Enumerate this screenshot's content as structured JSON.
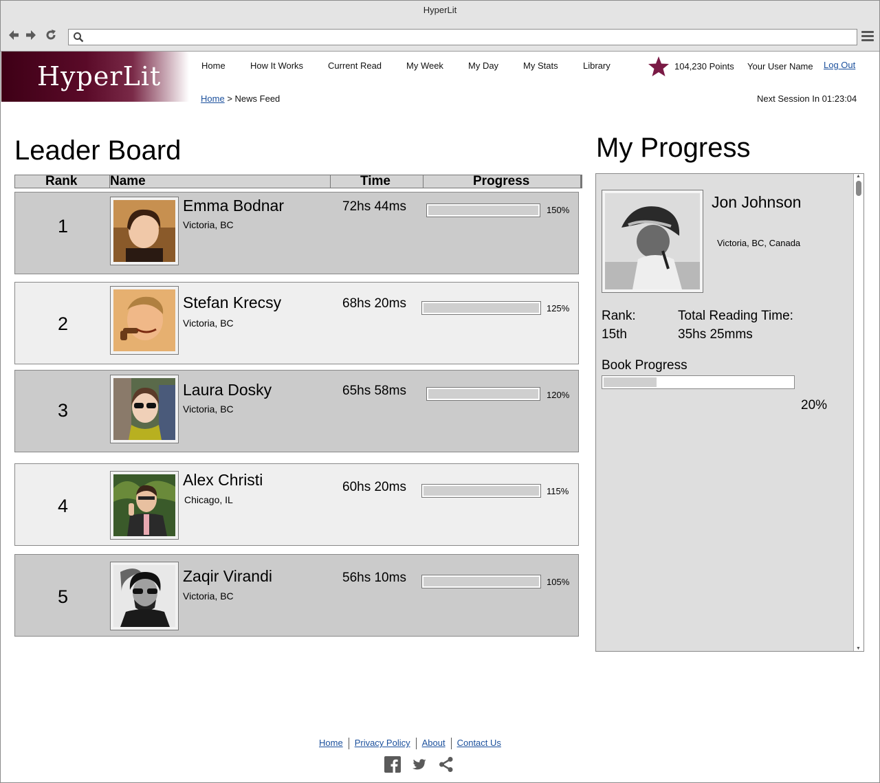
{
  "window": {
    "title": "HyperLit"
  },
  "browser": {
    "url": ""
  },
  "brand": {
    "logo_text": "HyperLit",
    "accent_color": "#5a0a28",
    "star_color": "#7a1a45"
  },
  "nav": {
    "items": [
      "Home",
      "How It Works",
      "Current Read",
      "My Week",
      "My Day",
      "My Stats",
      "Library"
    ]
  },
  "user_bar": {
    "points": "104,230 Points",
    "username": "Your User Name",
    "logout": "Log Out"
  },
  "breadcrumb": {
    "home": "Home",
    "separator": ">",
    "current": "News Feed"
  },
  "session": {
    "next": "Next Session In 01:23:04"
  },
  "leaderboard": {
    "title": "Leader Board",
    "columns": [
      "Rank",
      "Name",
      "Time",
      "Progress"
    ],
    "rows": [
      {
        "rank": "1",
        "name": "Emma Bodnar",
        "location": "Victoria, BC",
        "time": "72hs 44ms",
        "progress": "150%",
        "progress_value": 1.0
      },
      {
        "rank": "2",
        "name": "Stefan Krecsy",
        "location": "Victoria, BC",
        "time": "68hs 20ms",
        "progress": "125%",
        "progress_value": 1.0
      },
      {
        "rank": "3",
        "name": "Laura Dosky",
        "location": "Victoria, BC",
        "time": "65hs 58ms",
        "progress": "120%",
        "progress_value": 1.0
      },
      {
        "rank": "4",
        "name": "Alex Christi",
        "location": "Chicago, IL",
        "time": "60hs 20ms",
        "progress": "115%",
        "progress_value": 1.0
      },
      {
        "rank": "5",
        "name": "Zaqir Virandi",
        "location": "Victoria, BC",
        "time": "56hs 10ms",
        "progress": "105%",
        "progress_value": 1.0
      }
    ]
  },
  "my_progress": {
    "title": "My Progress",
    "name": "Jon Johnson",
    "location": "Victoria, BC, Canada",
    "rank_label": "Rank:",
    "rank_value": "15th",
    "time_label": "Total Reading Time:",
    "time_value": "35hs 25mms",
    "book_label": "Book Progress",
    "book_percent": "20%",
    "book_value": 0.28
  },
  "footer": {
    "links": [
      "Home",
      "Privacy Policy",
      "About",
      "Contact Us"
    ]
  },
  "social": {
    "icons": [
      "facebook-icon",
      "twitter-icon",
      "share-icon"
    ]
  }
}
